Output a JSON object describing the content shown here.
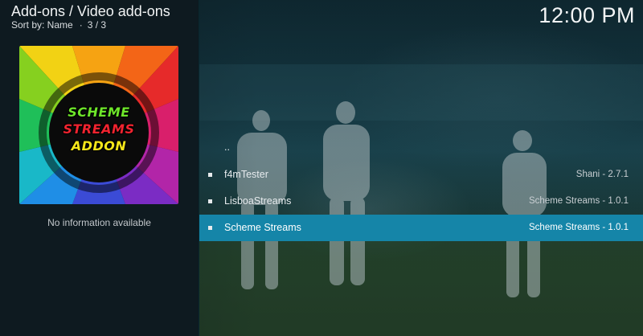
{
  "header": {
    "title": "Add-ons / Video add-ons",
    "sort_label": "Sort by: Name",
    "page_counter": "3 / 3"
  },
  "clock": "12:00 PM",
  "thumbnail": {
    "line1": "SCHEME",
    "line2": "STREAMS",
    "line3": "ADDON"
  },
  "info_text": "No information available",
  "list": {
    "parent_label": "..",
    "items": [
      {
        "name": "f4mTester",
        "meta": "Shani - 2.7.1"
      },
      {
        "name": "LisboaStreams",
        "meta": "Scheme Streams - 1.0.1"
      },
      {
        "name": "Scheme Streams",
        "meta": "Scheme Streams - 1.0.1"
      }
    ],
    "selected_index": 2
  },
  "colors": {
    "selection": "#1585a8",
    "panel": "#0e1a20"
  }
}
